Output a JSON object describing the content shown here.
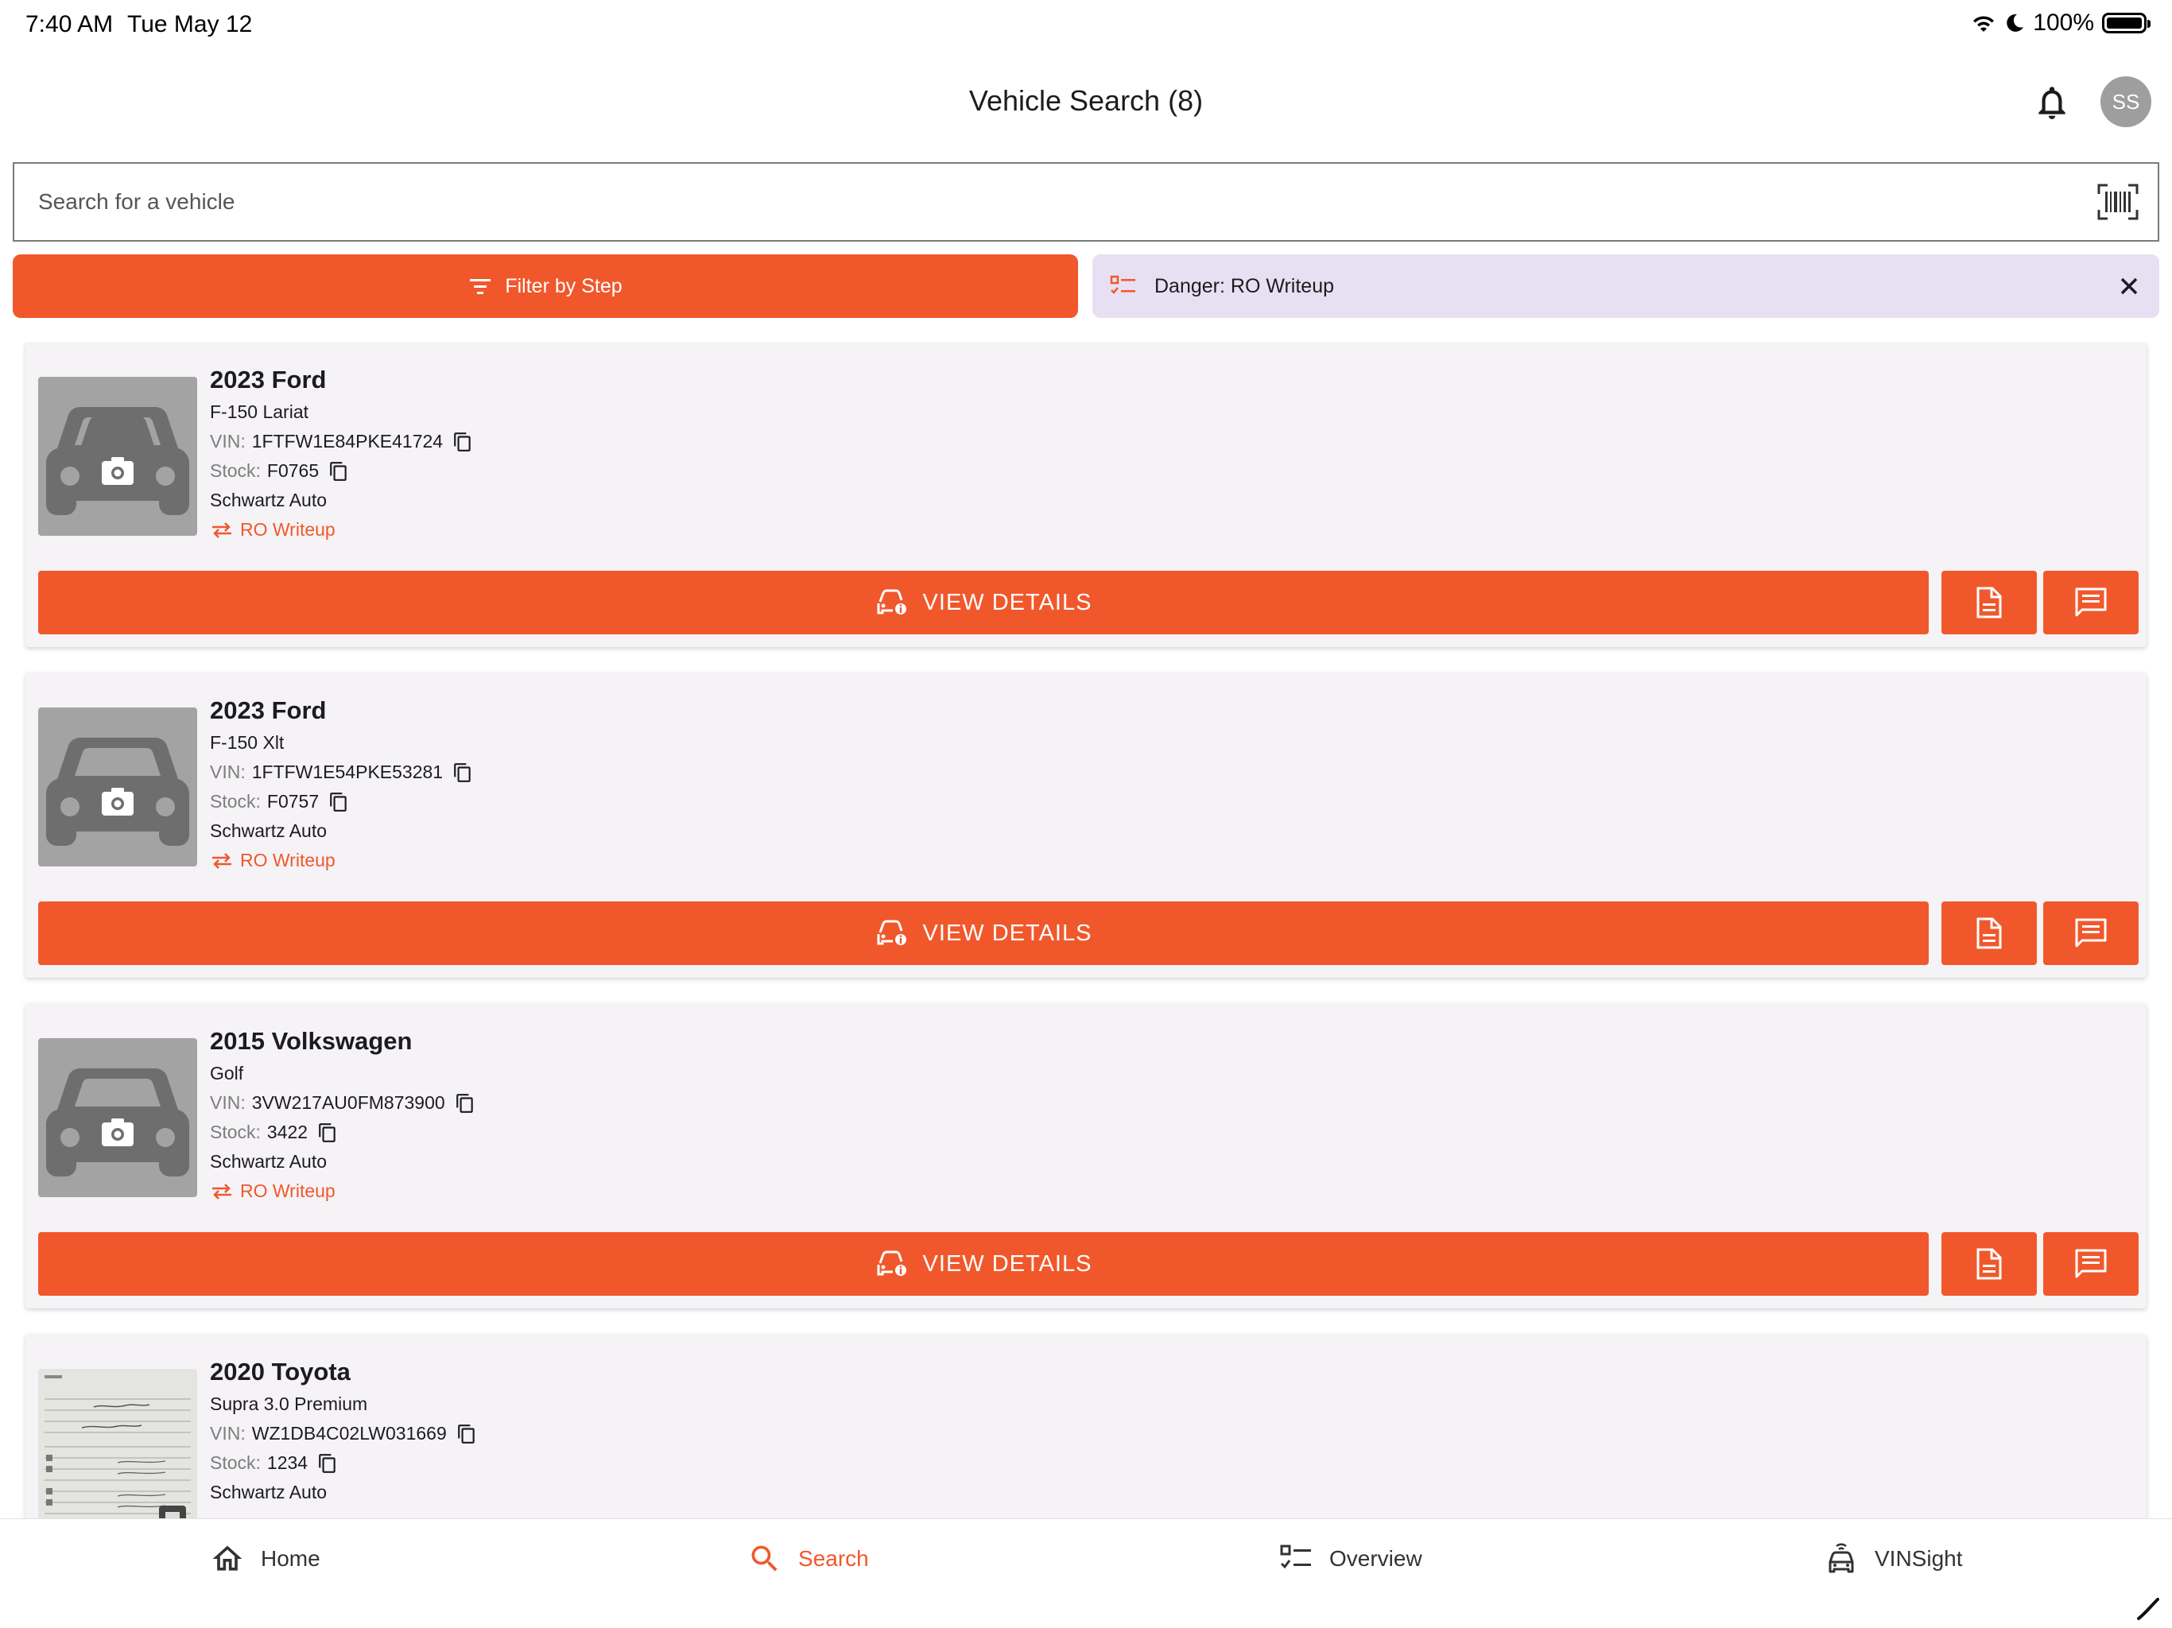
{
  "status_bar": {
    "time": "7:40 AM",
    "date": "Tue May 12",
    "battery": "100%"
  },
  "header": {
    "title": "Vehicle Search (8)",
    "avatar_initials": "SS"
  },
  "search": {
    "placeholder": "Search for a vehicle"
  },
  "filter": {
    "button_label": "Filter by Step",
    "active_chip": "Danger: RO Writeup"
  },
  "labels": {
    "vin": "VIN:",
    "stock": "Stock:",
    "view_details": "VIEW DETAILS"
  },
  "vehicles": [
    {
      "title": "2023 Ford",
      "trim": "F-150 Lariat",
      "vin": "1FTFW1E84PKE41724",
      "stock": "F0765",
      "dealer": "Schwartz Auto",
      "step": "RO Writeup",
      "image": "car-placeholder"
    },
    {
      "title": "2023 Ford",
      "trim": "F-150 Xlt",
      "vin": "1FTFW1E54PKE53281",
      "stock": "F0757",
      "dealer": "Schwartz Auto",
      "step": "RO Writeup",
      "image": "car-placeholder"
    },
    {
      "title": "2015 Volkswagen",
      "trim": "Golf",
      "vin": "3VW217AU0FM873900",
      "stock": "3422",
      "dealer": "Schwartz Auto",
      "step": "RO Writeup",
      "image": "car-placeholder"
    },
    {
      "title": "2020 Toyota",
      "trim": "Supra 3.0 Premium",
      "vin": "WZ1DB4C02LW031669",
      "stock": "1234",
      "dealer": "Schwartz Auto",
      "step": "",
      "image": "document-photo"
    }
  ],
  "nav": {
    "home": "Home",
    "search": "Search",
    "overview": "Overview",
    "vinsight": "VINSight"
  },
  "colors": {
    "accent": "#f0582c",
    "chip_bg": "#e7e0f3",
    "card_bg": "#f5f3f6"
  }
}
